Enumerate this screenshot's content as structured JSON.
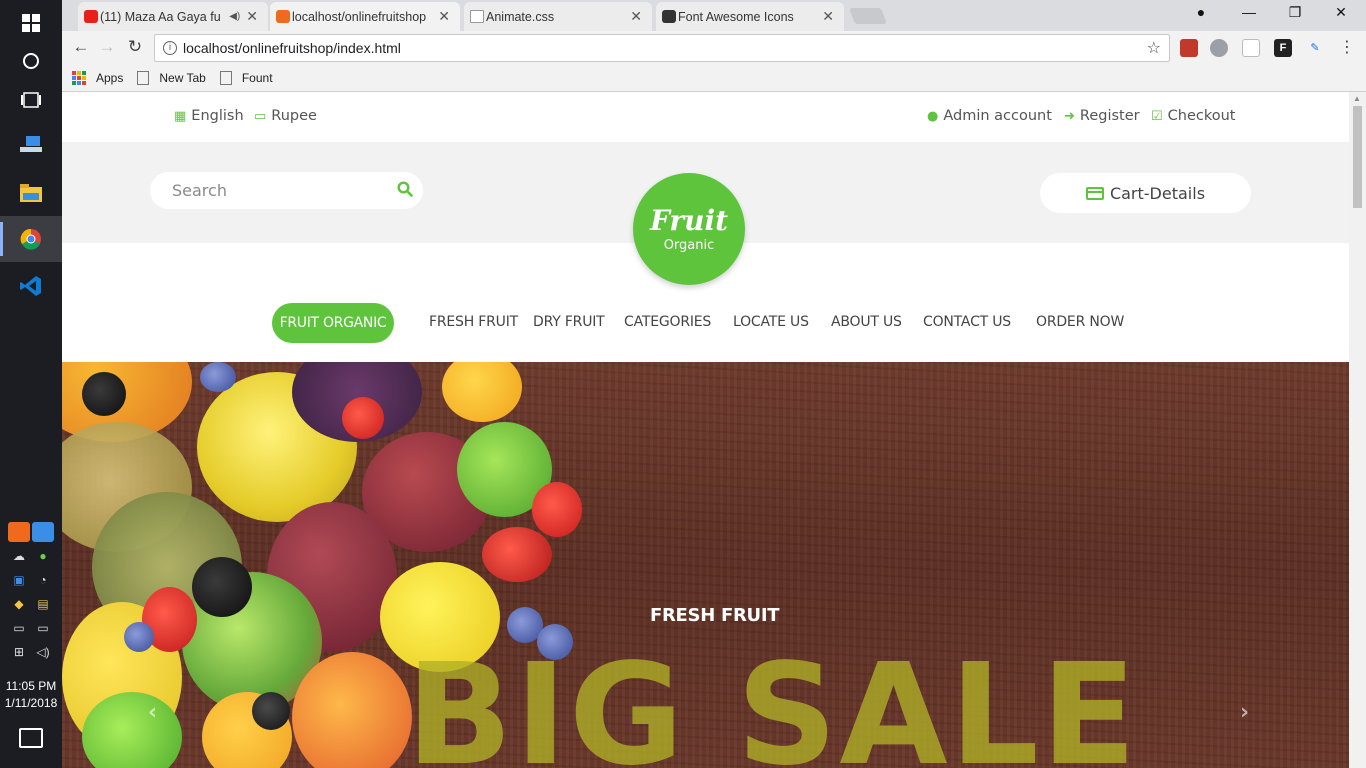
{
  "taskbar": {
    "clock_time": "11:05 PM",
    "clock_date": "1/11/2018"
  },
  "browser": {
    "tabs": [
      {
        "title": "(11) Maza Aa Gaya fu",
        "favicon_color": "#e62117"
      },
      {
        "title": "localhost/onlinefruitshop",
        "favicon_color": "#f06a1d"
      },
      {
        "title": "Animate.css",
        "favicon_color": "#ffffff"
      },
      {
        "title": "Font Awesome Icons",
        "favicon_color": "#333333"
      }
    ],
    "url": "localhost/onlinefruitshop/index.html",
    "bookmarks": [
      "Apps",
      "New Tab",
      "Fount"
    ]
  },
  "site": {
    "topbar": {
      "language": "English",
      "currency": "Rupee",
      "admin": "Admin account",
      "register": "Register",
      "checkout": "Checkout"
    },
    "search_placeholder": "Search",
    "cart_label": "Cart-Details",
    "logo": {
      "line1": "Fruit",
      "line2": "Organic"
    },
    "nav": {
      "active": "FRUIT ORGANIC",
      "items": [
        "FRESH FRUIT",
        "DRY FRUIT",
        "CATEGORIES",
        "LOCATE US",
        "ABOUT US",
        "CONTACT US",
        "ORDER NOW"
      ]
    },
    "hero": {
      "subtitle": "FRESH FRUIT",
      "title": "BIG SALE"
    },
    "colors": {
      "accent": "#5ec43c",
      "hero_text": "#afb026"
    }
  }
}
